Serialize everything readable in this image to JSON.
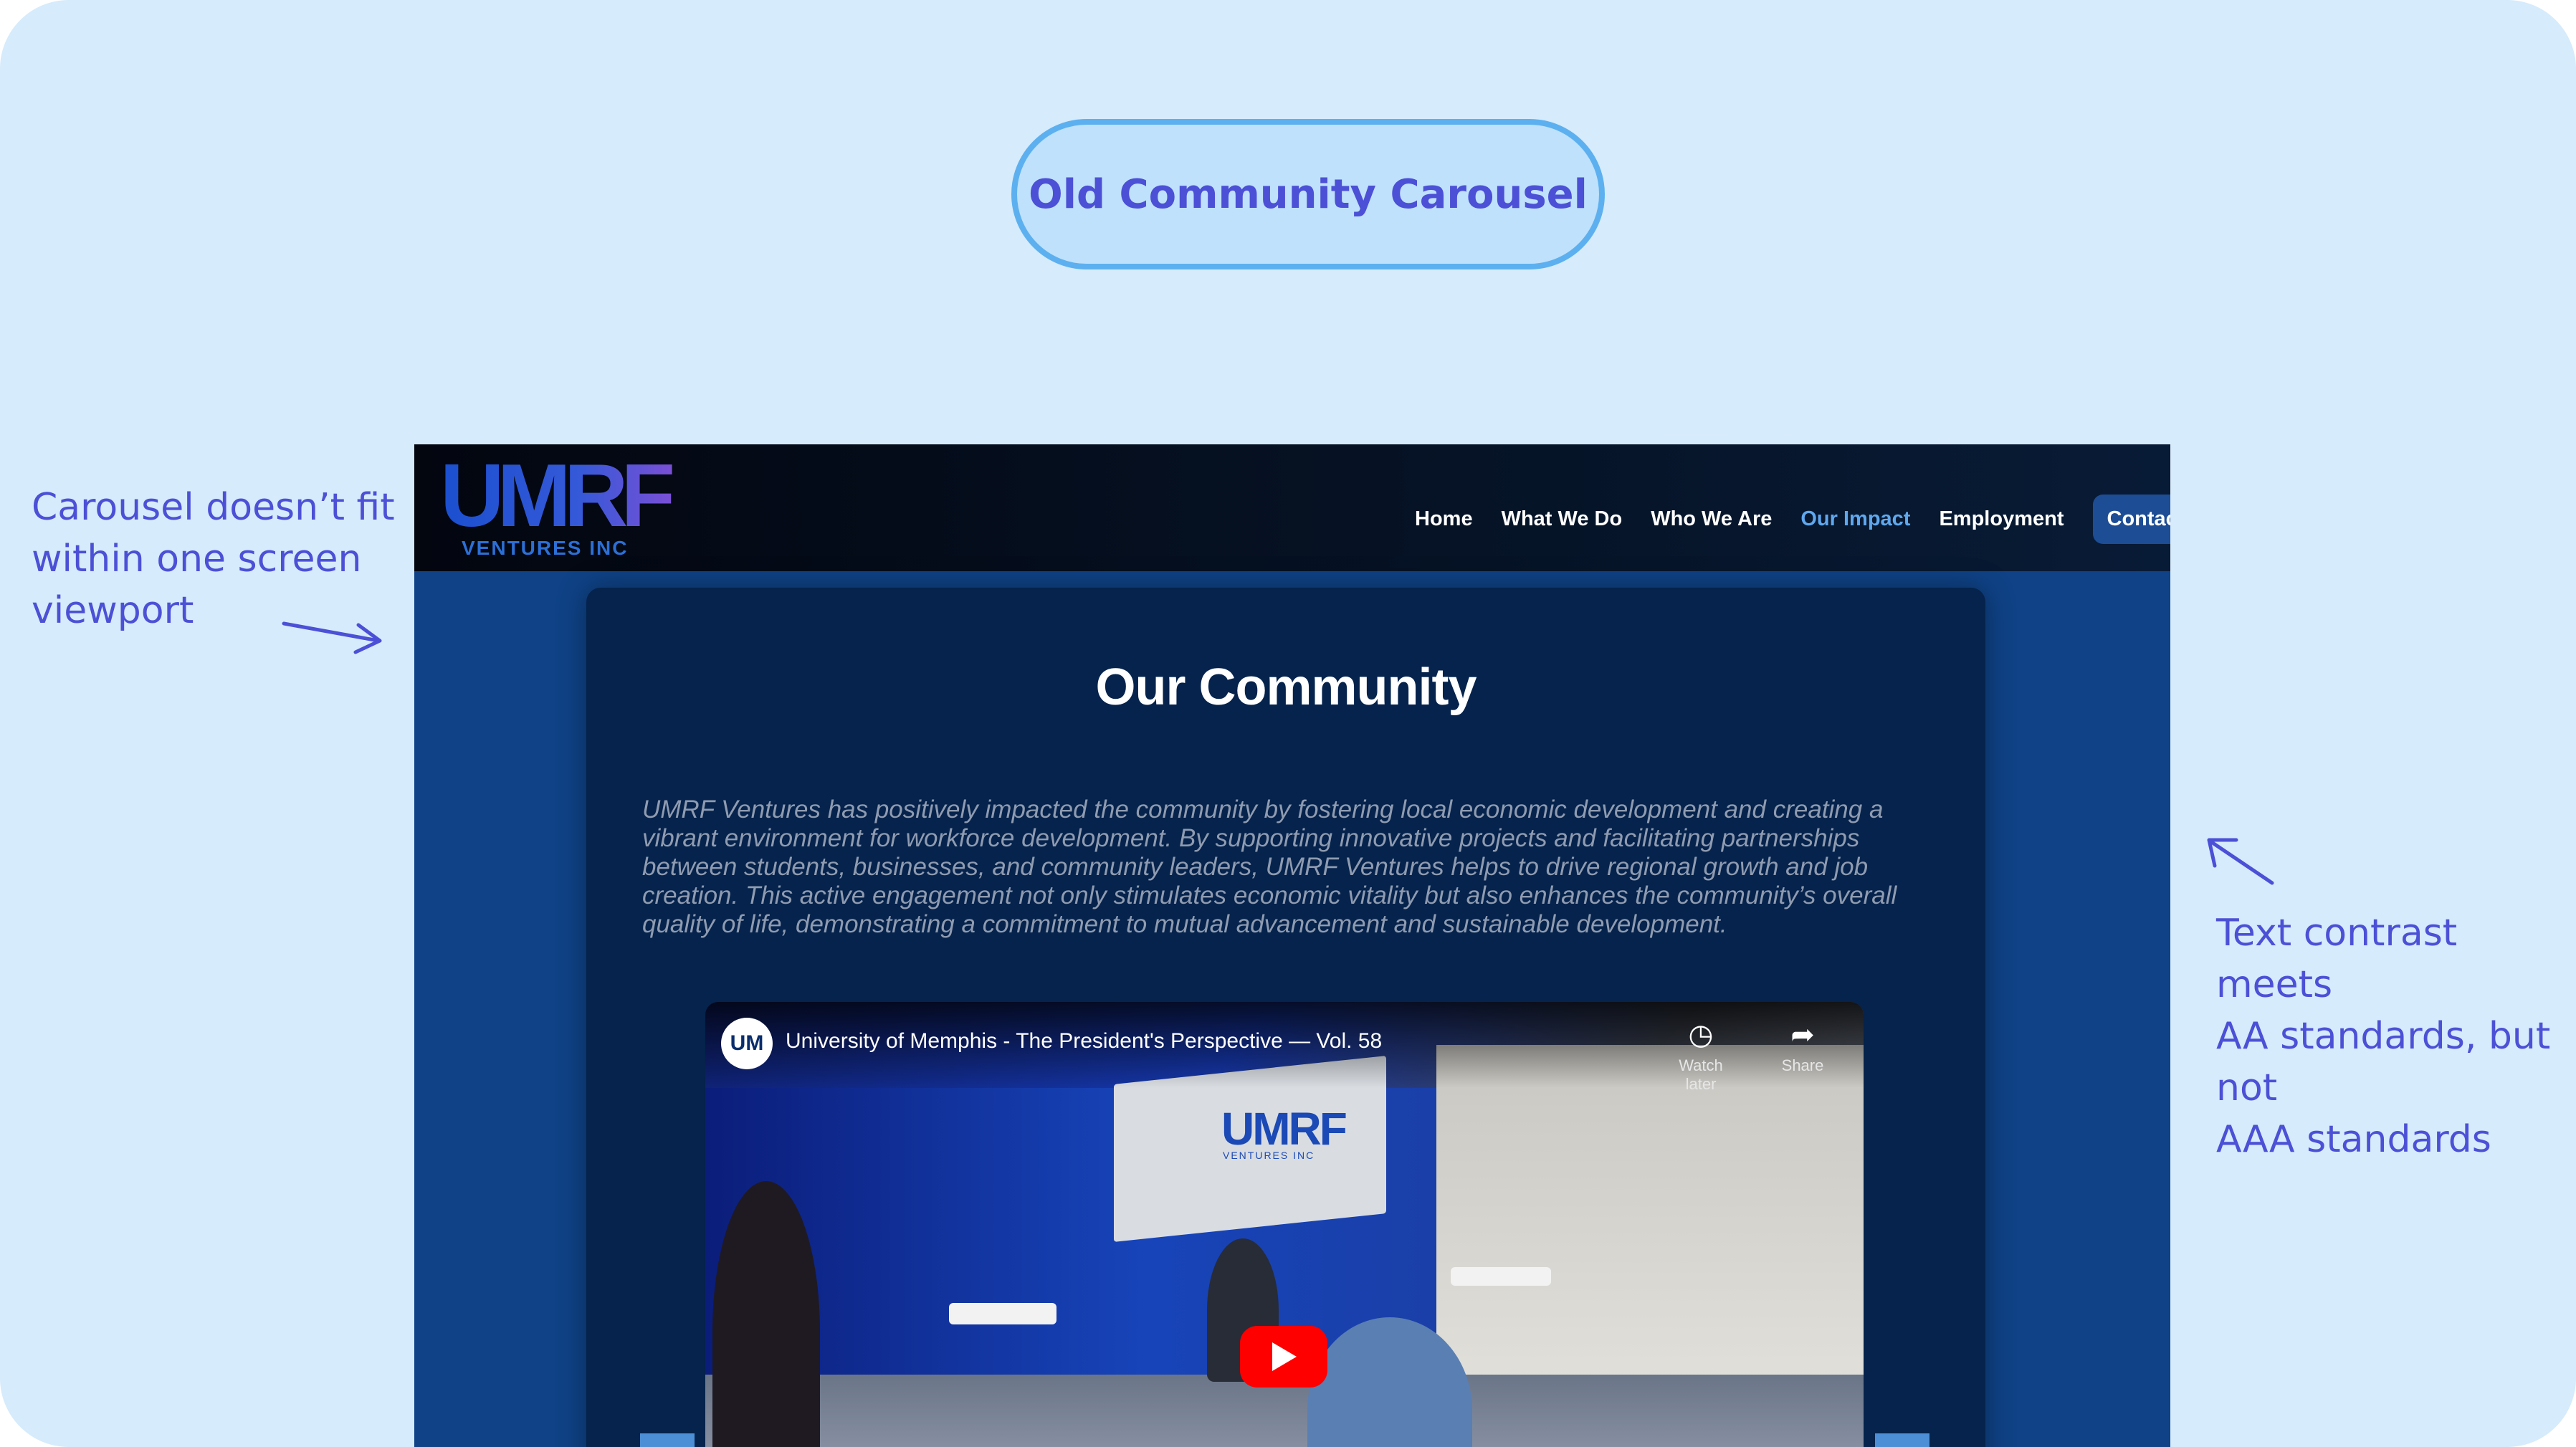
{
  "header": {
    "pill_label": "Old  Community Carousel"
  },
  "annotations": {
    "left": [
      "Carousel doesn’t fit",
      "within one  screen",
      "viewport"
    ],
    "right": [
      "Text contrast meets",
      "AA standards, but not",
      "AAA standards"
    ]
  },
  "site": {
    "logo": {
      "main": "UMRF",
      "sub": "VENTURES INC"
    },
    "nav": [
      {
        "label": "Home",
        "active": false
      },
      {
        "label": "What We Do",
        "active": false
      },
      {
        "label": "Who We Are",
        "active": false
      },
      {
        "label": "Our Impact",
        "active": true
      },
      {
        "label": "Employment",
        "active": false
      }
    ],
    "contact_label": "Contact Us",
    "section_title": "Our Community",
    "section_body": "UMRF Ventures has positively impacted the community by fostering local economic development and creating a vibrant environment for workforce development. By supporting innovative projects and facilitating partnerships between students, businesses, and community leaders, UMRF Ventures helps to drive regional growth and job creation. This active engagement not only stimulates economic vitality but also enhances the community’s overall quality of life, demonstrating a commitment to mutual advancement and sustainable development.",
    "video": {
      "channel_initials": "UM",
      "title": "University of Memphis - The President's Perspective — Vol. 58",
      "watch_later": "Watch later",
      "share": "Share",
      "sign_text": "UMRF",
      "sign_sub": "VENTURES INC"
    }
  },
  "colors": {
    "canvas": "#d6ebfb",
    "accent_text": "#4c50d6",
    "pill_border": "#5db0ef",
    "site_bg": "#0f4286",
    "panel_bg": "#05234c",
    "nav_active": "#5fa8ee"
  }
}
